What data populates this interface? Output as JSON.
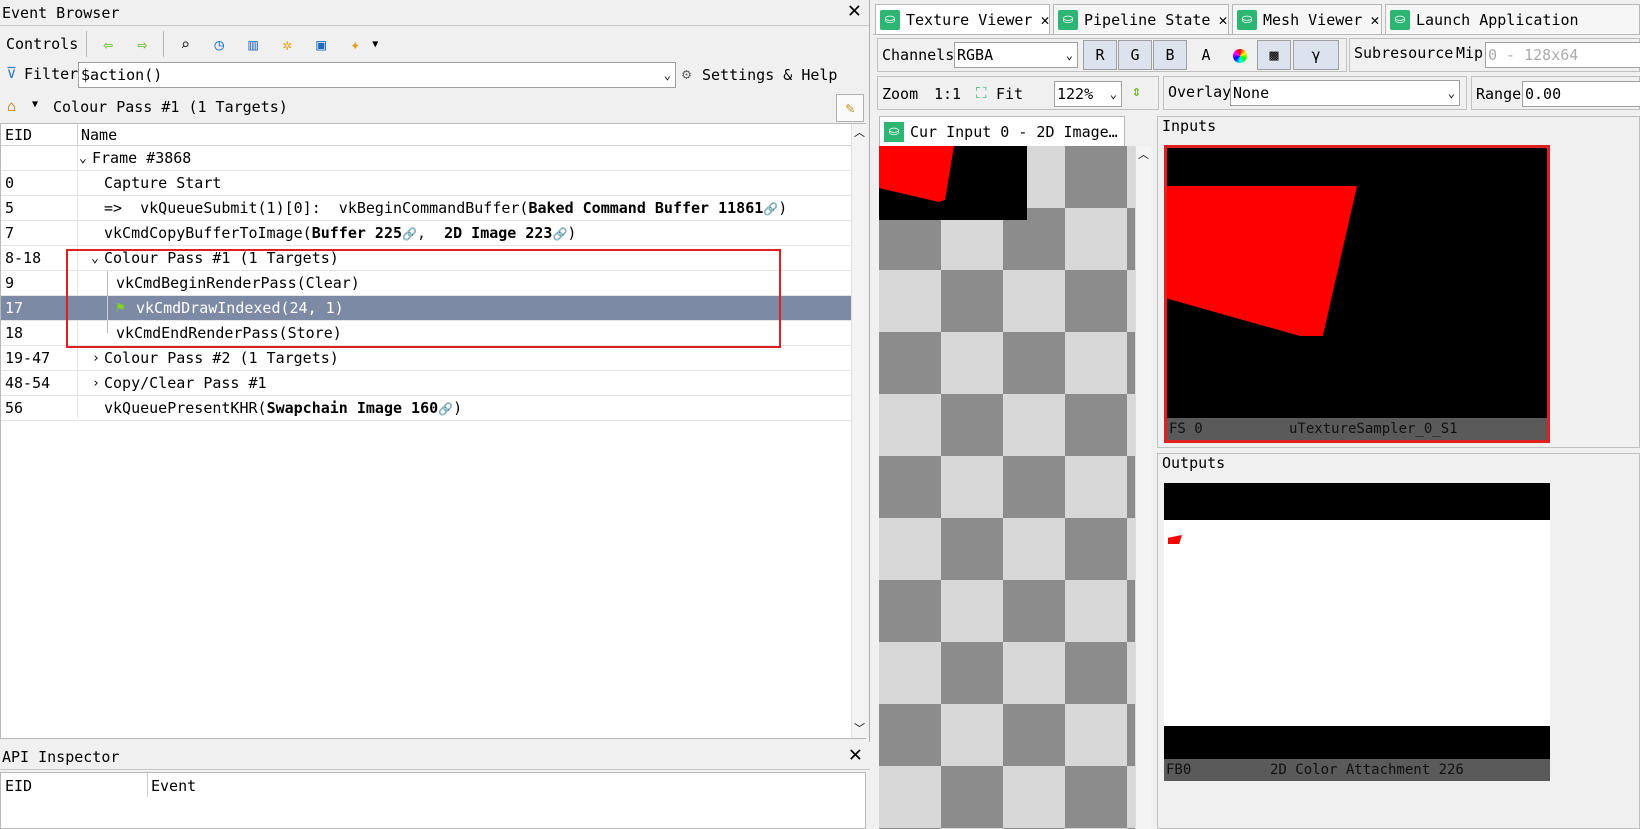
{
  "event_browser": {
    "title": "Event Browser",
    "close": "✕",
    "controls_label": "Controls",
    "filter_label": "Filter",
    "filter_value": "$action()",
    "settings_label": "Settings & Help",
    "breadcrumb": "Colour Pass #1 (1 Targets)",
    "col_eid": "EID",
    "col_name": "Name",
    "rows": [
      {
        "eid": "",
        "name": "Frame #3868"
      },
      {
        "eid": "0",
        "name": "Capture Start"
      },
      {
        "eid": "5",
        "prefix": "=>  vkQueueSubmit(1)[0]:  vkBeginCommandBuffer(",
        "bold": "Baked Command Buffer 11861",
        "suffix": ")"
      },
      {
        "eid": "7",
        "prefix": "vkCmdCopyBufferToImage(",
        "bold": "Buffer 225",
        "mid": ",  ",
        "bold2": "2D Image 223",
        "suffix": ")"
      },
      {
        "eid": "8-18",
        "name": "Colour Pass #1 (1 Targets)"
      },
      {
        "eid": "9",
        "name": "vkCmdBeginRenderPass(Clear)"
      },
      {
        "eid": "17",
        "name": "vkCmdDrawIndexed(24, 1)"
      },
      {
        "eid": "18",
        "name": "vkCmdEndRenderPass(Store)"
      },
      {
        "eid": "19-47",
        "name": "Colour Pass #2 (1 Targets)"
      },
      {
        "eid": "48-54",
        "name": "Copy/Clear Pass #1"
      },
      {
        "eid": "56",
        "prefix": "vkQueuePresentKHR(",
        "bold": "Swapchain Image 160",
        "suffix": ")"
      }
    ]
  },
  "api_inspector": {
    "title": "API Inspector",
    "close": "✕",
    "col_eid": "EID",
    "col_event": "Event"
  },
  "tabs": [
    {
      "label": "Texture Viewer",
      "close": "✕"
    },
    {
      "label": "Pipeline State",
      "close": "✕"
    },
    {
      "label": "Mesh Viewer",
      "close": "✕"
    },
    {
      "label": "Launch Application"
    }
  ],
  "texture_viewer": {
    "channels_label": "Channels",
    "channels_value": "RGBA",
    "channel_buttons": [
      "R",
      "G",
      "B",
      "A"
    ],
    "gamma": "γ",
    "subresource_label": "Subresource",
    "mip_label": "Mip",
    "mip_value": "0 - 128x64",
    "zoom_label": "Zoom",
    "zoom_11": "1:1",
    "fit_label": "Fit",
    "zoom_value": "122%",
    "overlay_label": "Overlay",
    "overlay_value": "None",
    "range_label": "Range",
    "range_value": "0.00",
    "cur_input_tab": "Cur Input 0 - 2D Image…",
    "inputs_label": "Inputs",
    "outputs_label": "Outputs",
    "input_thumb": {
      "slot": "FS 0",
      "name": "uTextureSampler_0_S1"
    },
    "output_thumb": {
      "slot": "FB0",
      "name": "2D Color Attachment 226"
    }
  },
  "colors": {
    "selection": "#7d8aa6",
    "highlight_box": "#e02020",
    "tab_icon": "#2db573"
  }
}
